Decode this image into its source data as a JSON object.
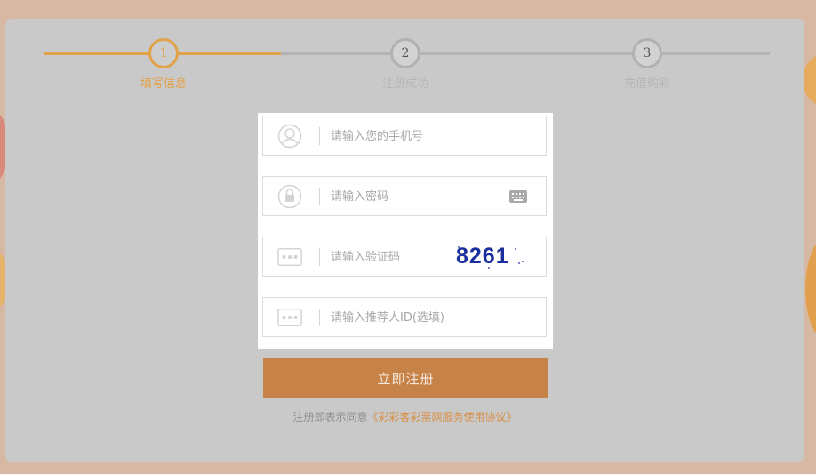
{
  "stepper": {
    "steps": [
      {
        "number": "1",
        "label": "填写信息",
        "state": "active"
      },
      {
        "number": "2",
        "label": "注册成功",
        "state": "inactive"
      },
      {
        "number": "3",
        "label": "充值购彩",
        "state": "inactive"
      }
    ]
  },
  "form": {
    "phone": {
      "placeholder": "请输入您的手机号",
      "icon": "user-icon"
    },
    "password": {
      "placeholder": "请输入密码",
      "icon": "lock-icon",
      "keyboard_icon": "keyboard-icon"
    },
    "captcha": {
      "placeholder": "请输入验证码",
      "icon": "dots-icon",
      "image_text": "8261"
    },
    "referrer": {
      "placeholder": "请输入推荐人ID(选填)",
      "icon": "dots-icon"
    }
  },
  "submit_label": "立即注册",
  "agreement": {
    "prefix": "注册即表示同意",
    "link_text": "《彩彩客彩票网服务使用协议》"
  },
  "colors": {
    "accent": "#e2a24a",
    "button": "#c78347",
    "card": "#c9c9c9",
    "background": "#d7b9a3"
  }
}
